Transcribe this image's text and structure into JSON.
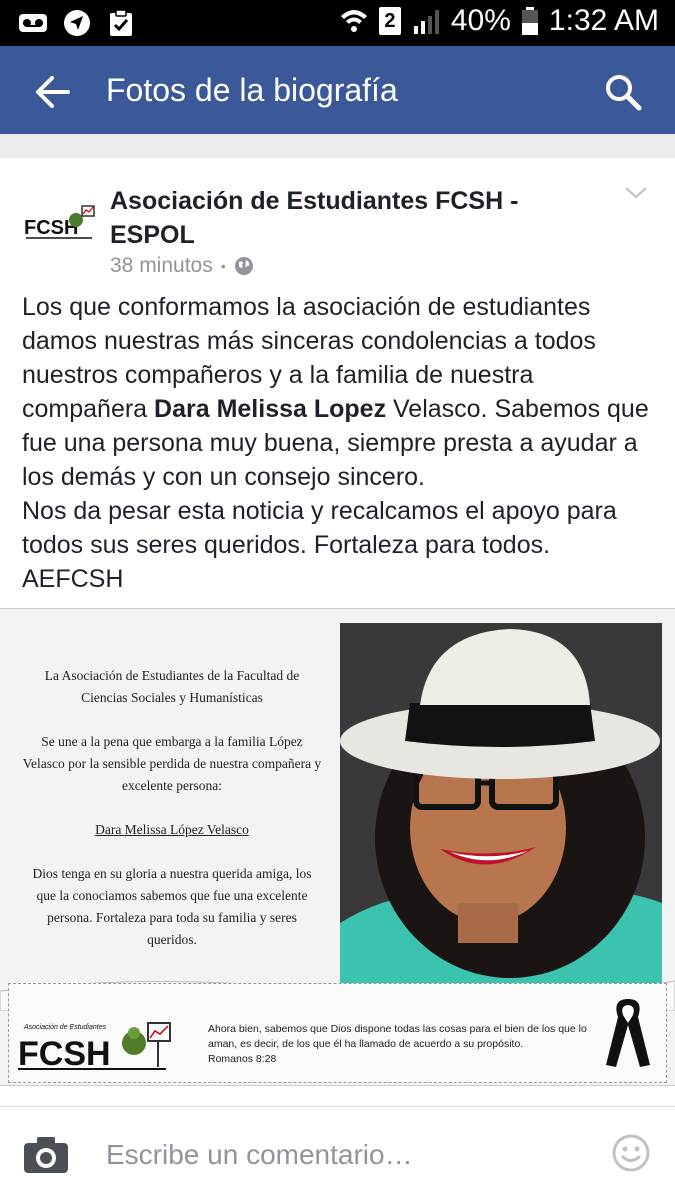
{
  "status_bar": {
    "sim_label": "2",
    "battery": "40%",
    "time": "1:32 AM"
  },
  "app_bar": {
    "title": "Fotos de la biografía"
  },
  "post": {
    "page_name": "Asociación de Estudiantes FCSH - ESPOL",
    "time_ago": "38 minutos",
    "separator": "•",
    "text_intro": "Los que conformamos la asociación de estudiantes damos nuestras más sinceras condolencias a todos nuestros compañeros y a la familia de nuestra compañera ",
    "text_bold_name": "Dara Melissa Lopez",
    "text_rest": " Velasco. Sabemos que fue una persona muy buena, siempre presta a ayudar a los demás y con un consejo sincero.",
    "text_line2": "Nos da pesar esta noticia y recalcamos el apoyo para todos sus seres queridos. Fortaleza para todos.",
    "text_line3": "AEFCSH"
  },
  "attachment": {
    "para1": "La Asociación de Estudiantes de la Facultad de Ciencias Sociales y Humanísticas",
    "para2": "Se une a la pena que embarga a la familia López Velasco por la sensible perdida de nuestra compañera y excelente persona:",
    "name": "Dara Melissa López Velasco",
    "para3": "Dios tenga en su gloria a nuestra querida amiga, los que la conociamos sabemos que fue una excelente persona. Fortaleza para toda su familia y seres queridos.",
    "logo_small_text": "Asociación de Estudiantes",
    "logo_text": "FCSH",
    "verse": "Ahora bien, sabemos que Dios dispone todas las cosas para el bien de los que lo aman, es decir, de los que él ha llamado de acuerdo a su propósito.",
    "verse_ref": "Romanos 8:28"
  },
  "comment_bar": {
    "placeholder": "Escribe un comentario…"
  },
  "colors": {
    "brand_blue": "#3b5998",
    "meta_gray": "#90949c"
  },
  "icons": [
    "voicemail-icon",
    "navigation-icon",
    "clipboard-icon",
    "wifi-icon",
    "sim-icon",
    "signal-icon",
    "battery-icon",
    "back-arrow-icon",
    "search-icon",
    "chevron-down-icon",
    "globe-icon",
    "camera-icon",
    "smiley-icon",
    "black-ribbon-icon"
  ]
}
